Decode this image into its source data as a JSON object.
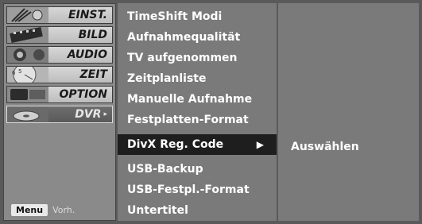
{
  "sidebar": {
    "items": [
      {
        "label": "EINST.",
        "icon": "satellite-dish-icon",
        "active": false
      },
      {
        "label": "BILD",
        "icon": "film-strip-icon",
        "active": false
      },
      {
        "label": "AUDIO",
        "icon": "speaker-icon",
        "active": false
      },
      {
        "label": "ZEIT",
        "icon": "clock-icon",
        "active": false
      },
      {
        "label": "OPTION",
        "icon": "special-icon",
        "active": false
      },
      {
        "label": "DVR",
        "icon": "disc-icon",
        "active": true
      }
    ],
    "active_arrow": "▸"
  },
  "hint": {
    "key": "Menu",
    "text": "Vorh."
  },
  "options": {
    "items": [
      {
        "label": "TimeShift Modi"
      },
      {
        "label": "Aufnahmequalität"
      },
      {
        "label": "TV aufgenommen"
      },
      {
        "label": "Zeitplanliste"
      },
      {
        "label": "Manuelle Aufnahme"
      },
      {
        "label": "Festplatten-Format"
      },
      {
        "label": "DivX Reg. Code",
        "selected": true
      },
      {
        "label": "USB-Backup"
      },
      {
        "label": "USB-Festpl.-Format"
      },
      {
        "label": "Untertitel"
      }
    ],
    "selected_arrow": "▶"
  },
  "submenu": {
    "label": "Auswählen"
  },
  "colors": {
    "background": "#5a5a5a",
    "panel": "#7a7a7a",
    "selected": "#1e1e1e",
    "text": "#ffffff"
  }
}
